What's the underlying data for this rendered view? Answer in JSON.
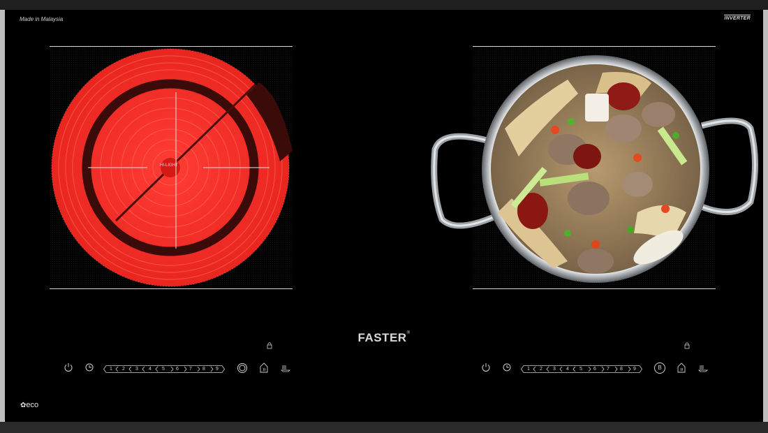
{
  "header": {
    "made_in": "Made in Malaysia",
    "inverter": "INVERTER"
  },
  "left_zone": {
    "label": "HI-LIGHT"
  },
  "brand": {
    "name": "FASTER",
    "mark": "®"
  },
  "left_controls": {
    "power_icon": "power-icon",
    "timer_icon": "timer-icon",
    "levels": [
      "1",
      "2",
      "3",
      "4",
      "5",
      "6",
      "7",
      "8",
      "9"
    ],
    "mode_icon": "dual-ring-icon",
    "keep_warm_icon": "keep-warm-icon",
    "grill_icon": "grill-icon",
    "lock_icon": "lock-icon"
  },
  "right_controls": {
    "power_icon": "power-icon",
    "timer_icon": "timer-icon",
    "levels": [
      "1",
      "2",
      "3",
      "4",
      "5",
      "6",
      "7",
      "8",
      "9"
    ],
    "mode_icon": "boost-icon",
    "mode_letter": "B",
    "keep_warm_icon": "keep-warm-icon",
    "grill_icon": "grill-icon",
    "lock_icon": "lock-icon"
  },
  "footer": {
    "eco": "eco",
    "eco_icon": "leaf-icon"
  },
  "colors": {
    "heater_red": "#f3312f",
    "heater_dark": "#2a0706",
    "panel_black": "#000000",
    "print_white": "#d9d9d9"
  }
}
